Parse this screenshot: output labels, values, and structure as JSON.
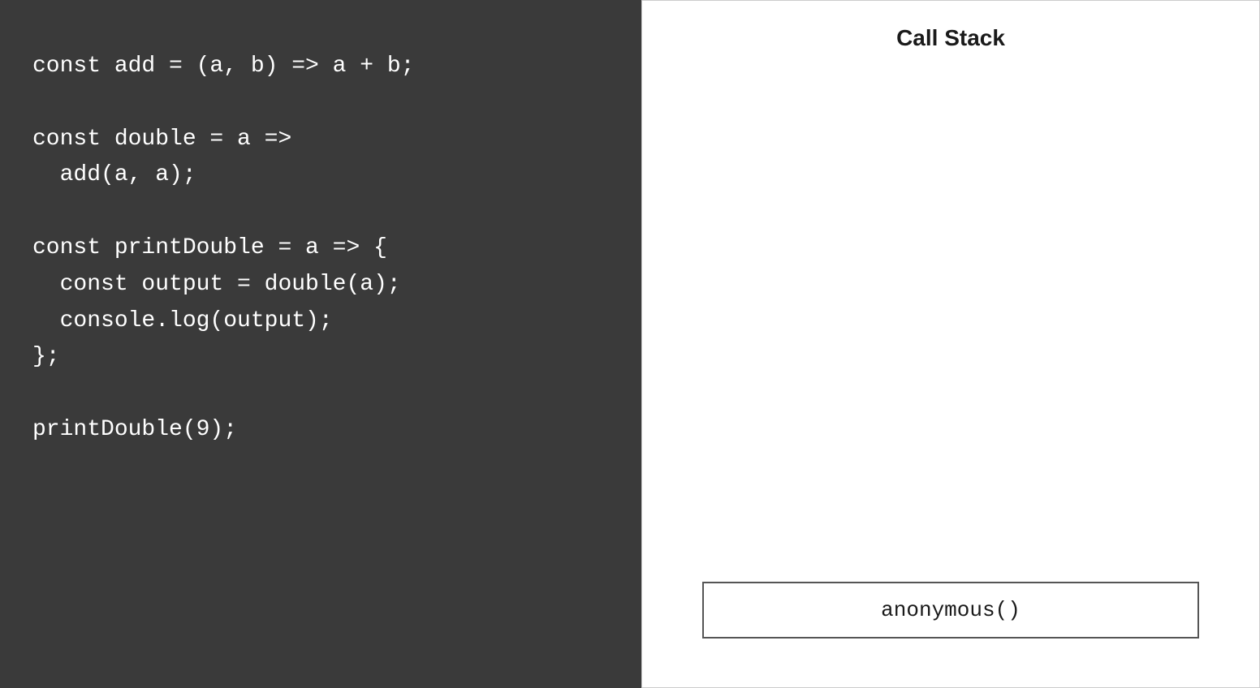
{
  "code_panel": {
    "background_color": "#3a3a3a",
    "code_lines": "const add = (a, b) => a + b;\n\nconst double = a =>\n  add(a, a);\n\nconst printDouble = a => {\n  const output = double(a);\n  console.log(output);\n};\n\nprintDouble(9);"
  },
  "call_stack_panel": {
    "title": "Call Stack",
    "items": [
      {
        "label": "anonymous()"
      }
    ]
  }
}
